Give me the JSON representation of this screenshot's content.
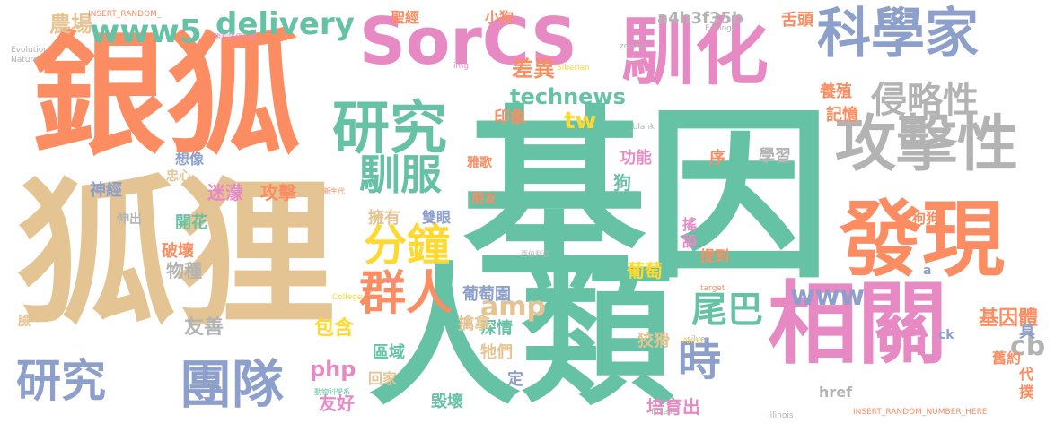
{
  "palette": {
    "teal": "#66c2a5",
    "orange": "#fc8d62",
    "blue": "#8da0cb",
    "pink": "#e78ac3",
    "green": "#a6d854",
    "yellow": "#ffd92f",
    "tan": "#e5c494",
    "gray": "#b3b3b3"
  },
  "words": [
    "基因",
    "人類",
    "狐狸",
    "銀狐",
    "發現",
    "相關",
    "馴化",
    "SorCS",
    "科學家",
    "攻擊性",
    "研究",
    "侵略性",
    "團隊",
    "研究",
    "群人",
    "分鐘",
    "時",
    "尾巴",
    "馴服",
    "delivery",
    "www5",
    "農場",
    "technews",
    "amp",
    "php",
    "cb",
    "www",
    "tw",
    "差異",
    "基因體",
    "養殖",
    "記憶",
    "舌頭",
    "印象",
    "功能",
    "序",
    "學習",
    "狗",
    "神經",
    "迷濛",
    "攻擊",
    "開花",
    "破壞",
    "物種",
    "友善",
    "包含",
    "擁有",
    "雙眼",
    "區域",
    "牠們",
    "深情",
    "擒拿",
    "葡萄",
    "葡萄園",
    "狡猾",
    "培育出",
    "友好",
    "回家",
    "毀壞",
    "定",
    "代",
    "具",
    "舊約",
    "撲",
    "提到",
    "搖",
    "舔",
    "狗狗",
    "a4b3f35b",
    "聖經",
    "小狗",
    "想像",
    "忠心",
    "伸出",
    "臉",
    "雅歌",
    "朋友",
    "href",
    "ck",
    "a",
    "INSERT_RANDOM_NUMBER_HERE",
    "INSERT_RANDOM_",
    "Evolution",
    "Nature",
    "College",
    "Illinois",
    "foxes",
    "silver",
    "target",
    "Anna",
    "Siberian",
    "zoneid",
    "Ecology",
    "img",
    "src",
    "_blank",
    "伊利諾伊大學",
    "動物科學系",
    "新生代",
    "西伯利亞"
  ]
}
